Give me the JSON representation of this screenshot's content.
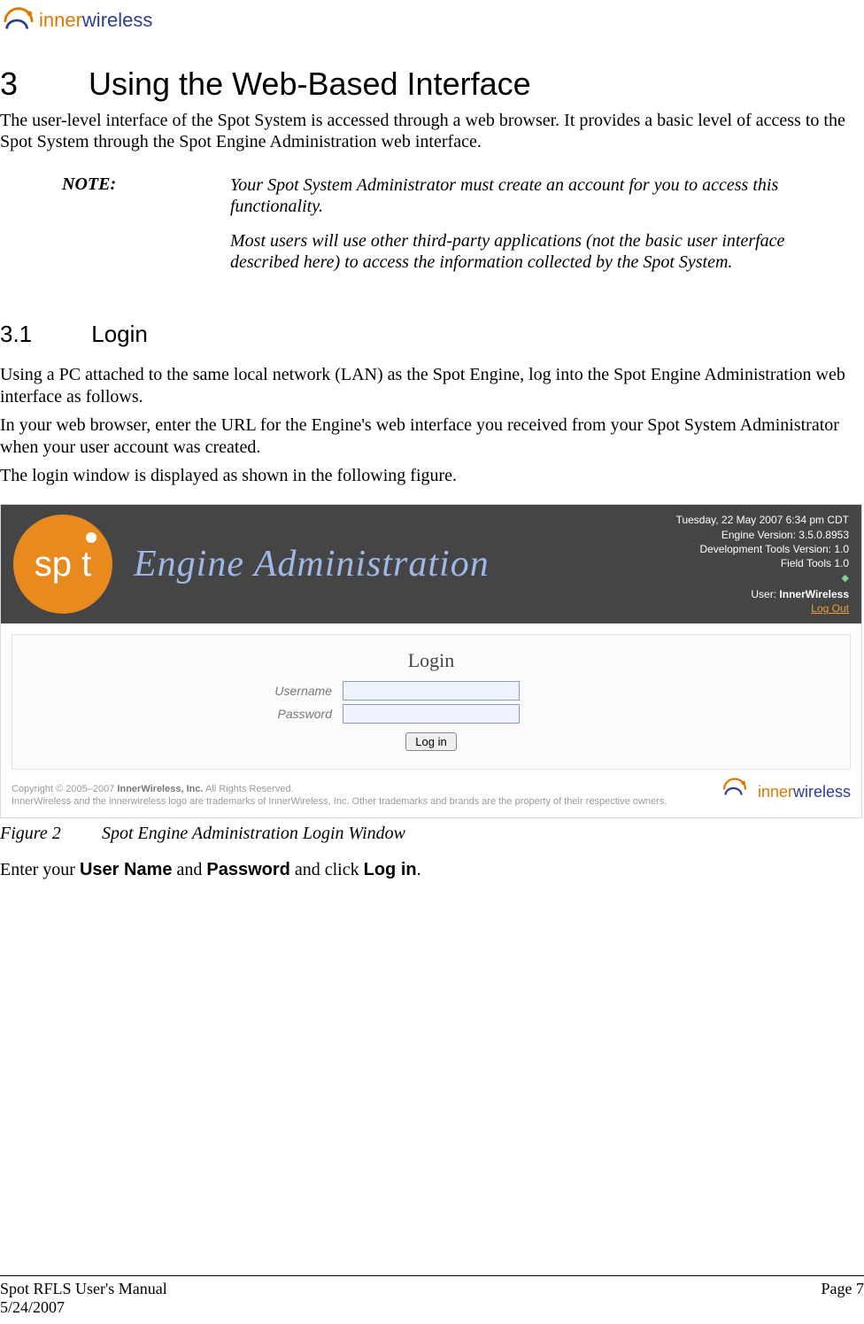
{
  "logo": {
    "inner": "inner",
    "wireless": "wireless"
  },
  "h1": {
    "num": "3",
    "title": "Using the Web-Based Interface"
  },
  "intro": "The user-level interface of the Spot System is accessed through a web browser. It provides a basic level of access to the Spot System through the Spot Engine Administration web interface.",
  "note": {
    "label": "NOTE:",
    "p1": "Your Spot System Administrator must create an account for you to access this functionality.",
    "p2": "Most users will use other third-party applications (not the basic user interface described here) to access the information collected by the Spot System."
  },
  "h2": {
    "num": "3.1",
    "title": "Login"
  },
  "body": {
    "p1": "Using a PC attached to the same local network (LAN) as the Spot Engine, log into the Spot Engine Administration web interface as follows.",
    "p2": "In your web browser, enter the URL for the Engine's web interface you received from your Spot System Administrator when your user account was created.",
    "p3": "The login window is displayed as shown in the following figure."
  },
  "screenshot": {
    "spot_label": "sp  t",
    "title": "Engine Administration",
    "info": {
      "datetime": "Tuesday, 22 May 2007 6:34 pm CDT",
      "engine_version": "Engine Version: 3.5.0.8953",
      "dev_tools": "Development Tools Version: 1.0",
      "field_tools": "Field Tools 1.0",
      "user_label": "User: ",
      "user_value": "InnerWireless",
      "logout": "Log Out"
    },
    "login": {
      "heading": "Login",
      "username_label": "Username",
      "password_label": "Password",
      "button": "Log in"
    },
    "footer": {
      "copyright_pre": "Copyright © 2005–2007 ",
      "copyright_bold": "InnerWireless, Inc.",
      "copyright_post": " All Rights Reserved.",
      "tm": "InnerWireless and the innerwireless logo are trademarks of InnerWireless, Inc. Other trademarks and brands are the property of their respective owners."
    }
  },
  "figcap": {
    "tag": "Figure 2",
    "text": "Spot Engine Administration Login Window"
  },
  "instruction": {
    "pre": "Enter your ",
    "b1": "User Name",
    "mid": " and ",
    "b2": "Password",
    "mid2": " and click ",
    "b3": "Log in",
    "post": "."
  },
  "footer": {
    "left1": "Spot RFLS User's Manual",
    "left2": "5/24/2007",
    "right": "Page 7"
  }
}
